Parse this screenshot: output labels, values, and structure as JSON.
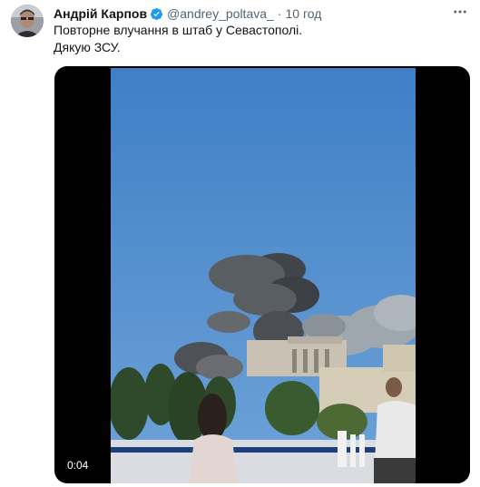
{
  "tweet": {
    "author_name": "Андрій Карпов",
    "handle": "@andrey_poltava_",
    "separator": "·",
    "timestamp": "10 год",
    "text_lines": [
      "Повторне влучання в штаб у Севастополі.",
      "Дякую ЗСУ."
    ],
    "verified": true,
    "more_icon": "more-horizontal-icon"
  },
  "video": {
    "duration": "0:04"
  },
  "colors": {
    "verified_blue": "#1d9bf0",
    "text_primary": "#0f1419",
    "text_secondary": "#536471",
    "sky": "#4a86c9"
  }
}
